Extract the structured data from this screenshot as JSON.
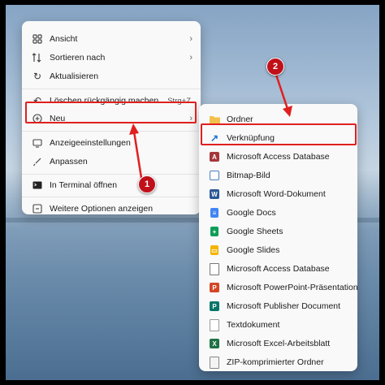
{
  "context_menu": {
    "items": [
      {
        "label": "Ansicht",
        "icon": "grid-icon"
      },
      {
        "label": "Sortieren nach",
        "icon": "sort-icon"
      },
      {
        "label": "Aktualisieren",
        "icon": "refresh-icon"
      },
      {
        "label": "Löschen rückgängig machen",
        "shortcut": "Strg+Z",
        "icon": "undo-icon"
      },
      {
        "label": "Neu",
        "icon": "plus-circle-icon"
      },
      {
        "label": "Anzeigeeinstellungen",
        "icon": "display-icon"
      },
      {
        "label": "Anpassen",
        "icon": "brush-icon"
      },
      {
        "label": "In Terminal öffnen",
        "icon": "terminal-icon"
      },
      {
        "label": "Weitere Optionen anzeigen",
        "icon": "more-options-icon"
      }
    ]
  },
  "submenu": {
    "items": [
      {
        "label": "Ordner",
        "icon": "folder-icon"
      },
      {
        "label": "Verknüpfung",
        "icon": "shortcut-arrow-icon"
      },
      {
        "label": "Microsoft Access Database",
        "icon": "access-icon"
      },
      {
        "label": "Bitmap-Bild",
        "icon": "bitmap-icon"
      },
      {
        "label": "Microsoft Word-Dokument",
        "icon": "word-icon"
      },
      {
        "label": "Google Docs",
        "icon": "google-docs-icon"
      },
      {
        "label": "Google Sheets",
        "icon": "google-sheets-icon"
      },
      {
        "label": "Google Slides",
        "icon": "google-slides-icon"
      },
      {
        "label": "Microsoft Access Database",
        "icon": "document-icon"
      },
      {
        "label": "Microsoft PowerPoint-Präsentation",
        "icon": "powerpoint-icon"
      },
      {
        "label": "Microsoft Publisher Document",
        "icon": "publisher-icon"
      },
      {
        "label": "Textdokument",
        "icon": "text-document-icon"
      },
      {
        "label": "Microsoft Excel-Arbeitsblatt",
        "icon": "excel-icon"
      },
      {
        "label": "ZIP-komprimierter Ordner",
        "icon": "zip-folder-icon"
      }
    ]
  },
  "annotations": {
    "badge1": "1",
    "badge2": "2",
    "color": "#e02020"
  }
}
